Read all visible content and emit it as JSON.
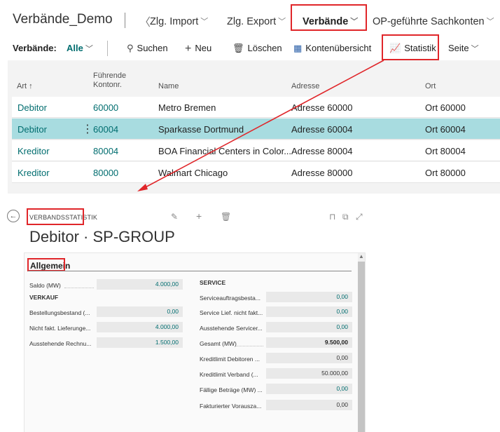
{
  "navbar": {
    "title": "Verbände_Demo",
    "items": [
      {
        "label": "Zlg. Import"
      },
      {
        "label": "Zlg. Export"
      },
      {
        "label": "Verbände"
      },
      {
        "label": "OP-geführte Sachkonten"
      }
    ]
  },
  "actionbar": {
    "filter_label": "Verbände:",
    "filter_value": "Alle",
    "search": "Suchen",
    "new": "Neu",
    "delete": "Löschen",
    "overview": "Kontenübersicht",
    "statistics": "Statistik",
    "page": "Seite"
  },
  "grid": {
    "columns": {
      "art": "Art ↑",
      "konto_line1": "Führende",
      "konto_line2": "Kontonr.",
      "name": "Name",
      "adresse": "Adresse",
      "ort": "Ort"
    },
    "rows": [
      {
        "art": "Debitor",
        "konto": "60000",
        "name": "Metro Bremen",
        "adresse": "Adresse 60000",
        "ort": "Ort 60000",
        "selected": false
      },
      {
        "art": "Debitor",
        "konto": "60004",
        "name": "Sparkasse Dortmund",
        "adresse": "Adresse 60004",
        "ort": "Ort 60004",
        "selected": true
      },
      {
        "art": "Kreditor",
        "konto": "80004",
        "name": "BOA Financial Centers in Color...",
        "adresse": "Adresse 80004",
        "ort": "Ort 80004",
        "selected": false
      },
      {
        "art": "Kreditor",
        "konto": "80000",
        "name": "Walmart Chicago",
        "adresse": "Adresse 80000",
        "ort": "Ort 80000",
        "selected": false
      }
    ]
  },
  "card": {
    "caption": "VERBANDSSTATISTIK",
    "title": "Debitor · SP-GROUP",
    "group": "Allgemein",
    "left": {
      "saldo_label": "Saldo (MW)",
      "saldo_value": "4.000,00",
      "section": "VERKAUF",
      "fields": [
        {
          "label": "Bestellungsbestand (...",
          "value": "0,00"
        },
        {
          "label": "Nicht fakt. Lieferunge...",
          "value": "4.000,00"
        },
        {
          "label": "Ausstehende Rechnu...",
          "value": "1.500,00"
        }
      ]
    },
    "right": {
      "section": "SERVICE",
      "fields": [
        {
          "label": "Serviceauftragsbesta...",
          "value": "0,00"
        },
        {
          "label": "Service Lief. nicht fakt...",
          "value": "0,00"
        },
        {
          "label": "Ausstehende Servicer...",
          "value": "0,00"
        },
        {
          "label": "Gesamt (MW)",
          "value": "9.500,00"
        },
        {
          "label": "Kreditlimit Debitoren ...",
          "value": "0,00"
        },
        {
          "label": "Kreditlimit Verband (...",
          "value": "50.000,00"
        },
        {
          "label": "Fällige Beträge (MW) ...",
          "value": "0,00"
        },
        {
          "label": "Fakturierter Vorausza...",
          "value": "0,00"
        }
      ]
    }
  },
  "colors": {
    "accent": "#006d6f",
    "selected_row": "#a8dce0",
    "highlight": "#e0262a"
  }
}
